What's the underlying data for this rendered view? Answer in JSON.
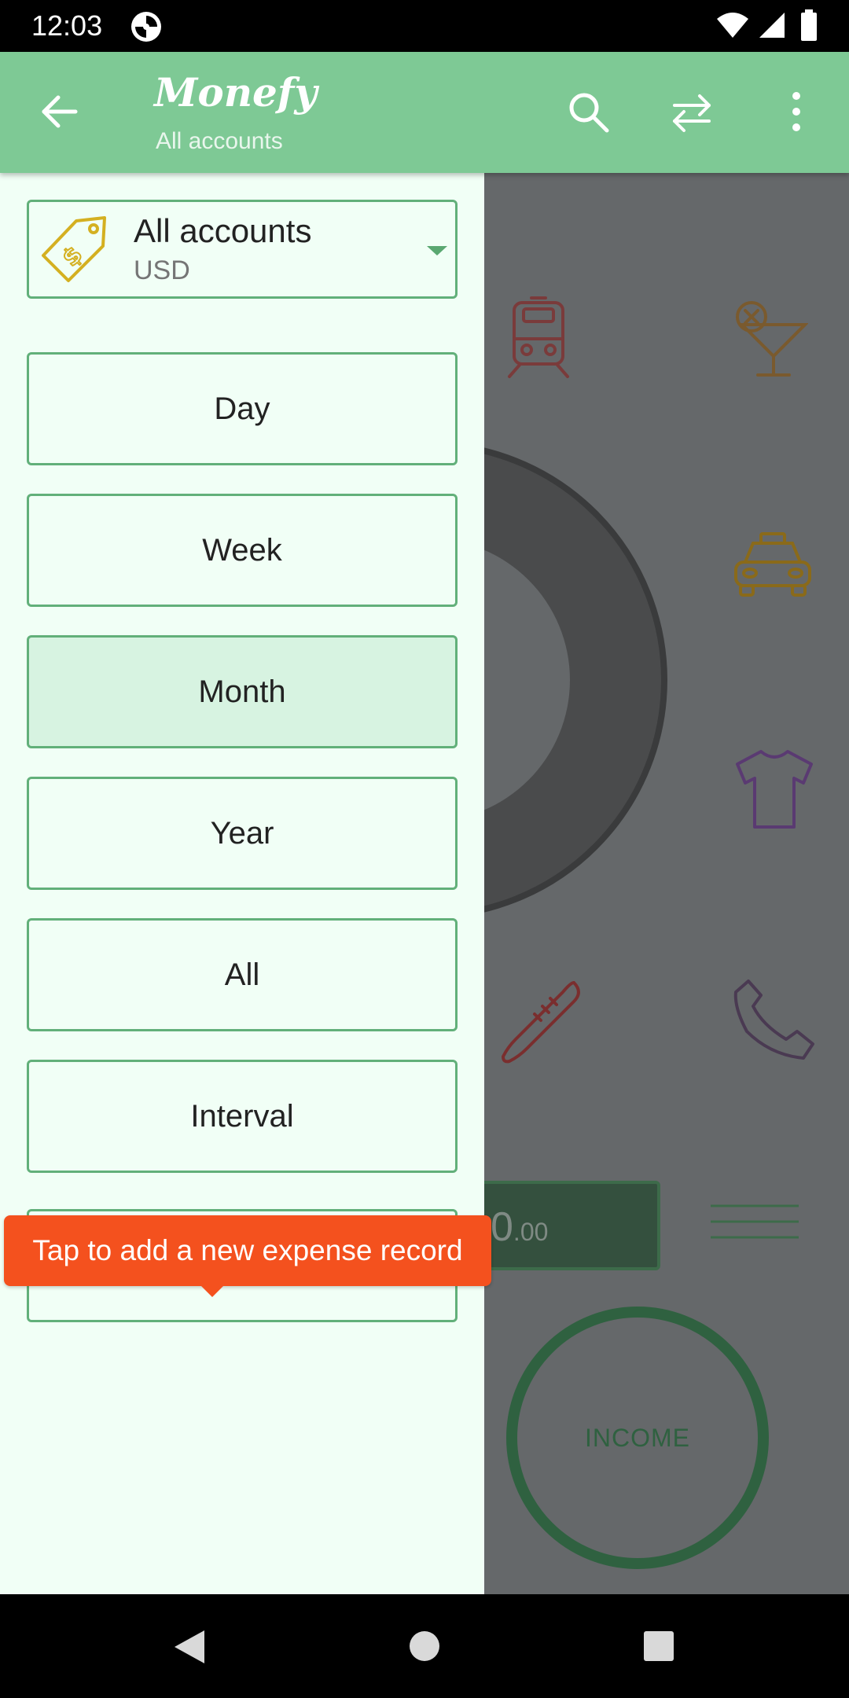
{
  "status_bar": {
    "time": "12:03",
    "icons": [
      "app-notification-icon",
      "wifi-icon",
      "signal-icon",
      "battery-icon"
    ]
  },
  "app_bar": {
    "title": "Monefy",
    "subtitle": "All accounts",
    "icons": [
      "back-arrow-icon",
      "search-icon",
      "transfer-icon",
      "more-vert-icon"
    ],
    "color": "#7ec995"
  },
  "drawer": {
    "account": {
      "name": "All accounts",
      "currency": "USD",
      "icon": "price-tag-icon"
    },
    "periods": [
      {
        "label": "Day",
        "selected": false
      },
      {
        "label": "Week",
        "selected": false
      },
      {
        "label": "Month",
        "selected": true
      },
      {
        "label": "Year",
        "selected": false
      },
      {
        "label": "All",
        "selected": false
      },
      {
        "label": "Interval",
        "selected": false
      },
      {
        "label": "",
        "selected": false
      }
    ]
  },
  "tooltip": {
    "text": "Tap to add a new expense record",
    "color": "#f4511e"
  },
  "main": {
    "category_icons": [
      "train-icon",
      "cocktail-icon",
      "taxi-icon",
      "tshirt-icon",
      "thermometer-icon",
      "phone-icon"
    ],
    "balance": {
      "value": "0",
      "cents": ".00"
    },
    "income_label": "INCOME"
  },
  "nav_bar": {
    "icons": [
      "nav-back-icon",
      "nav-home-icon",
      "nav-recents-icon"
    ]
  }
}
